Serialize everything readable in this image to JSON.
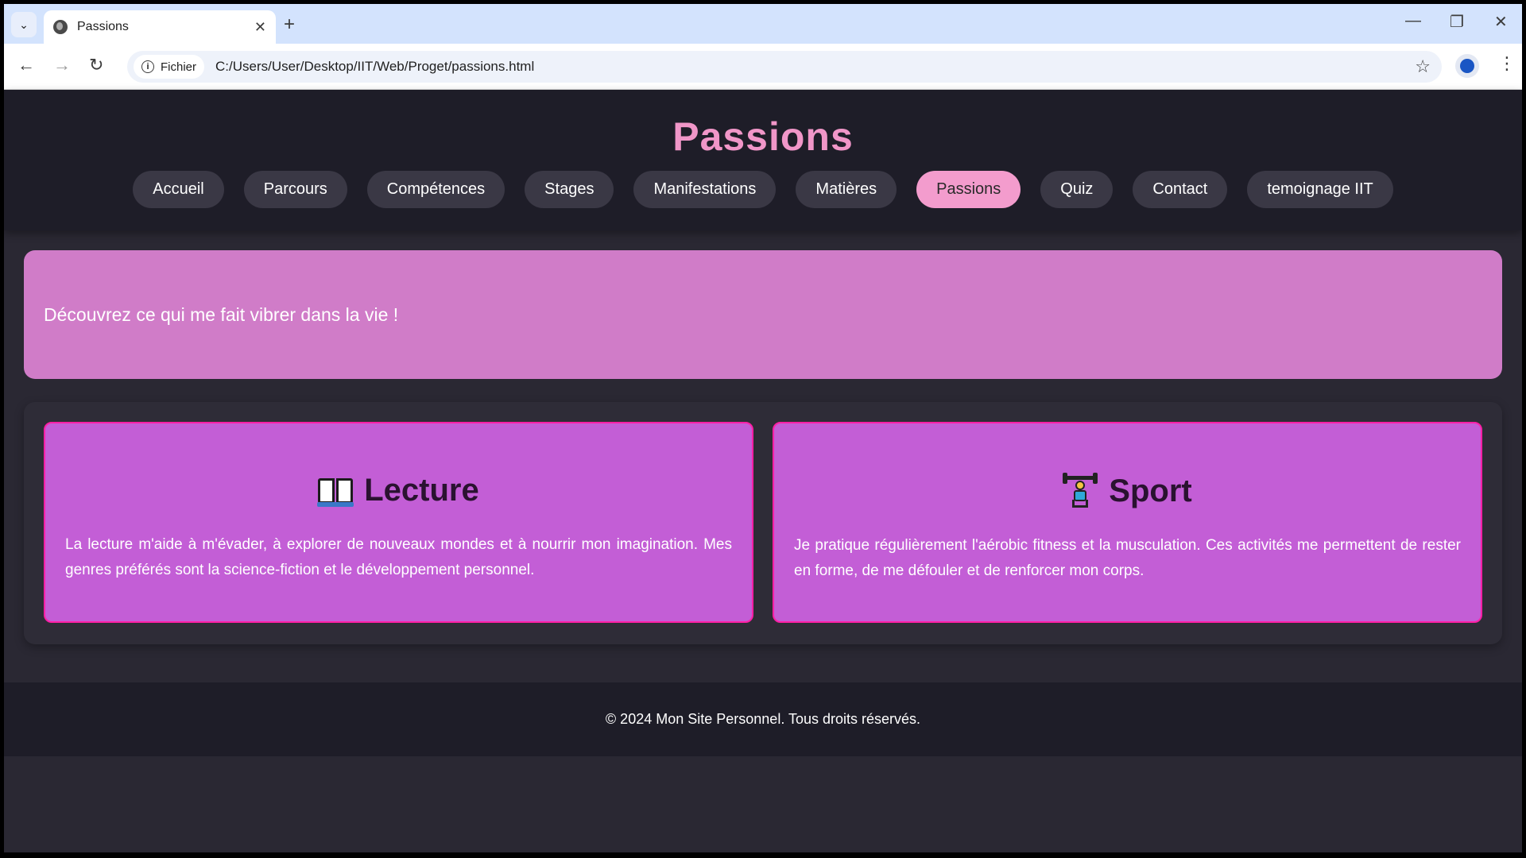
{
  "browser": {
    "tab_title": "Passions",
    "tab_close": "✕",
    "new_tab": "+",
    "scheme_label": "Fichier",
    "url": "C:/Users/User/Desktop/IIT/Web/Proget/passions.html",
    "minimize": "—",
    "restore": "❐",
    "close": "✕",
    "back": "←",
    "forward": "→",
    "reload": "↻",
    "bookmark": "☆",
    "menu": "⋮",
    "tab_search": "⌄",
    "info": "i"
  },
  "header": {
    "title": "Passions"
  },
  "nav": {
    "items": [
      {
        "label": "Accueil"
      },
      {
        "label": "Parcours"
      },
      {
        "label": "Compétences"
      },
      {
        "label": "Stages"
      },
      {
        "label": "Manifestations"
      },
      {
        "label": "Matières"
      },
      {
        "label": "Passions",
        "active": true
      },
      {
        "label": "Quiz"
      },
      {
        "label": "Contact"
      },
      {
        "label": "temoignage IIT"
      }
    ]
  },
  "hero": {
    "text": "Découvrez ce qui me fait vibrer dans la vie !"
  },
  "cards": [
    {
      "icon": "open-book-icon",
      "title": "Lecture",
      "text": "La lecture m'aide à m'évader, à explorer de nouveaux mondes et à nourrir mon imagination. Mes genres préférés sont la science-fiction et le développement personnel."
    },
    {
      "icon": "weight-lifter-icon",
      "title": "Sport",
      "text": "Je pratique régulièrement l'aérobic fitness et la musculation. Ces activités me permettent de rester en forme, de me défouler et de renforcer mon corps."
    }
  ],
  "footer": {
    "text": "© 2024 Mon Site Personnel. Tous droits réservés."
  },
  "colors": {
    "title_pink": "#f096c8",
    "nav_active": "#f39ccd",
    "hero_bg": "#d07cc8",
    "card_bg": "#c35ed6",
    "card_border": "#ff1fa6",
    "page_bg": "#2a2833",
    "header_bg": "#1e1d28"
  }
}
